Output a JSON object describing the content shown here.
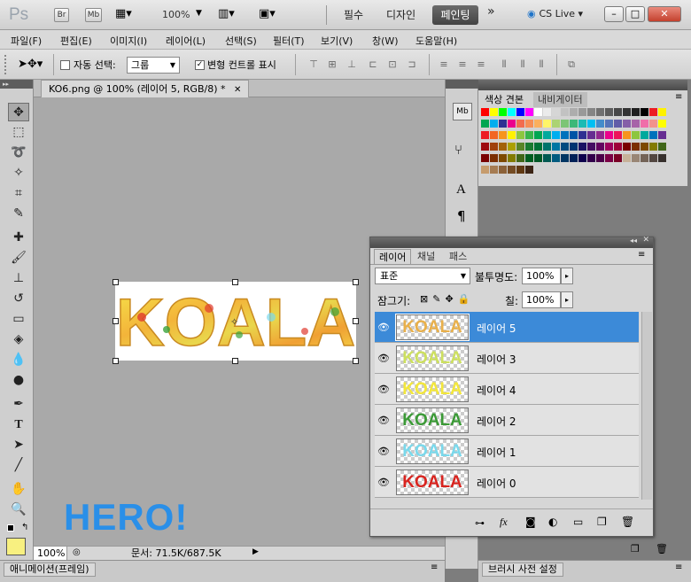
{
  "app": {
    "logo": "Ps",
    "bridge_label": "Br",
    "minibridge_label": "Mb",
    "zoom": "100%",
    "workspaces": [
      "필수",
      "디자인"
    ],
    "active_workspace": "페인팅",
    "more": "»",
    "cslive": "CS Live"
  },
  "menu": [
    "파일(F)",
    "편집(E)",
    "이미지(I)",
    "레이어(L)",
    "선택(S)",
    "필터(T)",
    "보기(V)",
    "창(W)",
    "도움말(H)"
  ],
  "options": {
    "auto_select_label": "자동 선택:",
    "auto_select_value": "그룹",
    "transform_controls_label": "변형 컨트롤 표시"
  },
  "document": {
    "tab_title": "KO6.png @ 100% (레이어 5, RGB/8) *",
    "image_text": "KOALA",
    "status_zoom": "100%",
    "status_doc": "문서: 71.5K/687.5K"
  },
  "watermark": "HERO!",
  "swatches": {
    "tabs": [
      "색상 견본",
      "내비게이터"
    ]
  },
  "layers_panel": {
    "tabs": [
      "레이어",
      "채널",
      "패스"
    ],
    "blend_mode": "표준",
    "opacity_label": "불투명도:",
    "opacity_value": "100%",
    "lock_label": "잠그기:",
    "fill_label": "칠:",
    "fill_value": "100%",
    "layers": [
      {
        "name": "레이어 5",
        "selected": true,
        "thumb_color": "#e9b04a"
      },
      {
        "name": "레이어 3",
        "selected": false,
        "thumb_color": "#cde05e"
      },
      {
        "name": "레이어 4",
        "selected": false,
        "thumb_color": "#f3e73b"
      },
      {
        "name": "레이어 2",
        "selected": false,
        "thumb_color": "#3b9a36"
      },
      {
        "name": "레이어 1",
        "selected": false,
        "thumb_color": "#7ad9ec"
      },
      {
        "name": "레이어 0",
        "selected": false,
        "thumb_color": "#d9241f"
      }
    ]
  },
  "bottom": {
    "animation_panel": "애니메이션(프레임)",
    "brush_panel": "브러시 사전 설정"
  },
  "colors": {
    "selection_blue": "#3c8ad8",
    "watermark_blue": "#2a8fe8",
    "foreground": "#f8f080"
  }
}
